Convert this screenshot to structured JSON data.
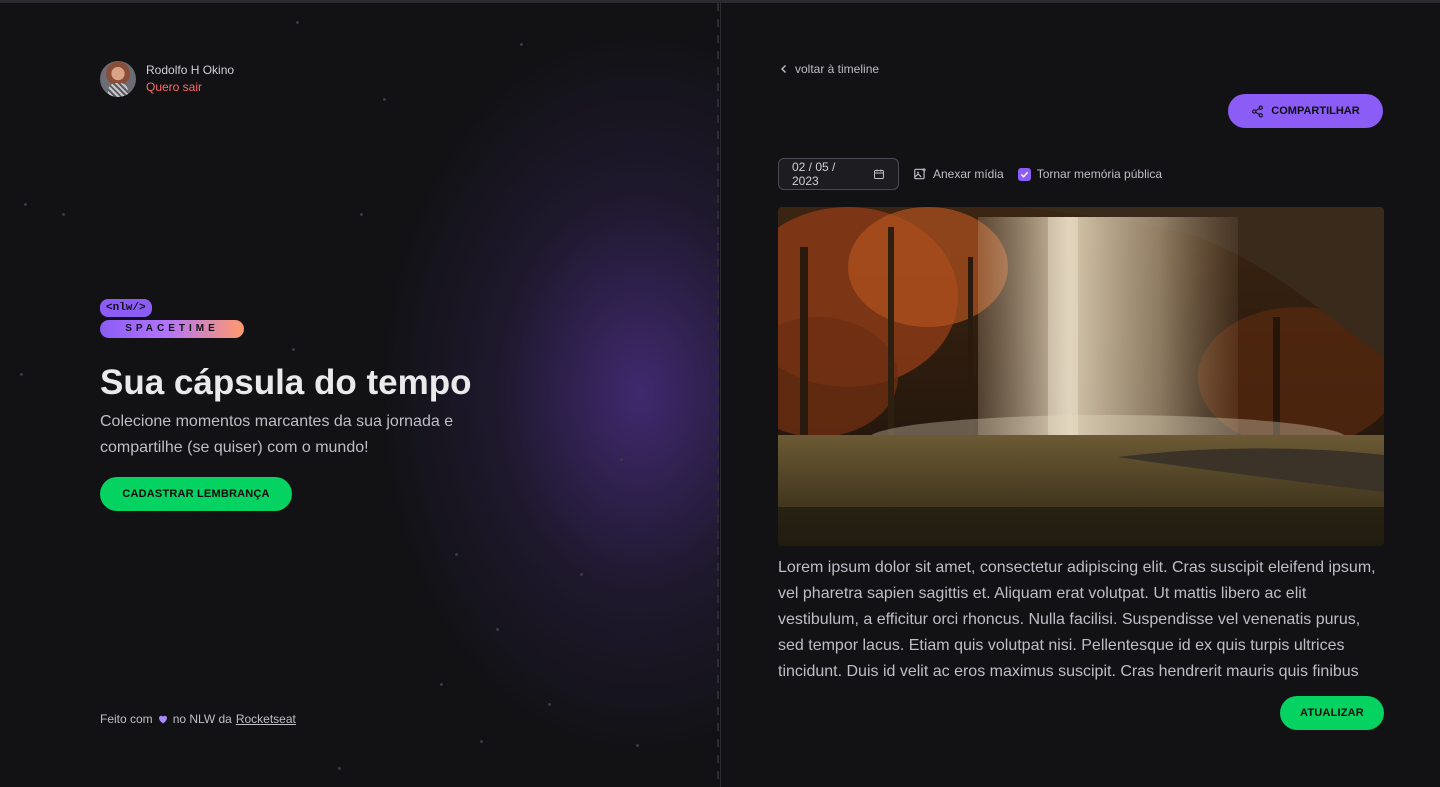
{
  "user": {
    "name": "Rodolfo H Okino",
    "logout_label": "Quero sair"
  },
  "logo": {
    "tag": "<nlw/>",
    "name": "SPACETIME"
  },
  "hero": {
    "title": "Sua cápsula do tempo",
    "subtitle": "Colecione momentos marcantes da sua jornada e compartilhe (se quiser) com o mundo!",
    "cta_label": "CADASTRAR LEMBRANÇA"
  },
  "footer": {
    "prefix": "Feito com",
    "middle": "no NLW da",
    "link": "Rocketseat"
  },
  "memory": {
    "back_label": "voltar à timeline",
    "share_label": "COMPARTILHAR",
    "date_value": "02 / 05 / 2023",
    "attach_label": "Anexar mídia",
    "public_label": "Tornar memória pública",
    "public_checked": true,
    "content": "Lorem ipsum dolor sit amet, consectetur adipiscing elit. Cras suscipit eleifend ipsum, vel pharetra sapien sagittis et. Aliquam erat volutpat. Ut mattis libero ac elit vestibulum, a efficitur orci rhoncus. Nulla facilisi. Suspendisse vel venenatis purus, sed tempor lacus. Etiam quis volutpat nisi. Pellentesque id ex quis turpis ultrices tincidunt. Duis id velit ac eros maximus suscipit. Cras hendrerit mauris quis finibus",
    "update_label": "ATUALIZAR"
  },
  "colors": {
    "background": "#121215",
    "purple": "#8b5cf6",
    "green": "#04d361",
    "logout_red": "#ff6a6a"
  }
}
